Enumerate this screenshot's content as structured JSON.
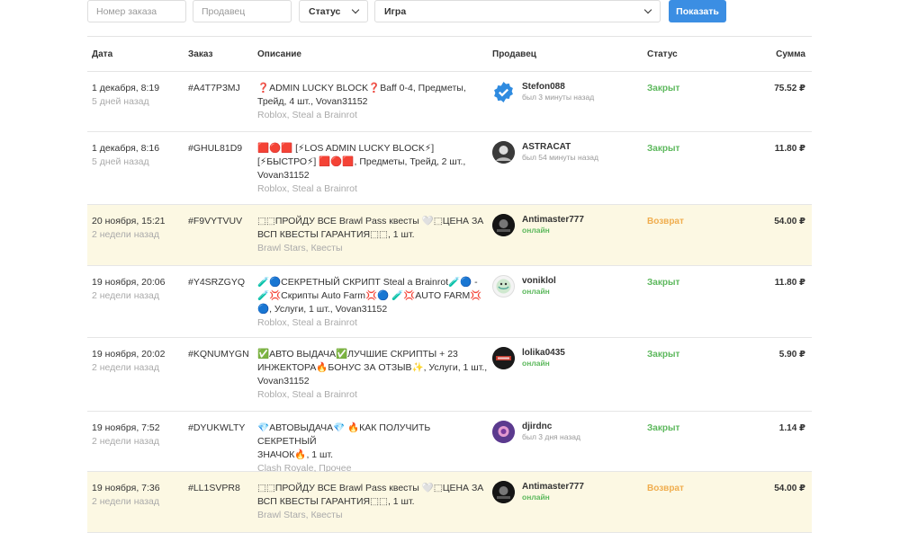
{
  "filters": {
    "order_placeholder": "Номер заказа",
    "seller_placeholder": "Продавец",
    "status_label": "Статус",
    "game_label": "Игра",
    "show_button": "Показать"
  },
  "table": {
    "headers": {
      "date": "Дата",
      "order": "Заказ",
      "description": "Описание",
      "seller": "Продавец",
      "status": "Статус",
      "amount": "Сумма"
    },
    "rows": [
      {
        "date": "1 декабря, 8:19",
        "ago": "5 дней назад",
        "order": "#A4T7P3MJ",
        "desc_lines": [
          "❓ADMIN LUCKY BLOCK❓Baff 0-4, Предметы,",
          "Трейд, 4 шт., Vovan31152"
        ],
        "category": "Roblox, Steal a Brainrot",
        "seller": "Stefon088",
        "seller_status": "был 3 минуты назад",
        "status": "Закрыт",
        "amount": "75.52 ₽"
      },
      {
        "date": "1 декабря, 8:16",
        "ago": "5 дней назад",
        "order": "#GHUL81D9",
        "desc_lines": [
          "🟥🔴🟥 [⚡LOS ADMIN LUCKY BLOCK⚡]",
          "[⚡БЫСТРО⚡] 🟥🔴🟥, Предметы, Трейд, 2 шт.,",
          "Vovan31152"
        ],
        "category": "Roblox, Steal a Brainrot",
        "seller": "ASTRACAT",
        "seller_status": "был 54 минуты назад",
        "status": "Закрыт",
        "amount": "11.80 ₽"
      },
      {
        "date": "20 ноября, 15:21",
        "ago": "2 недели назад",
        "order": "#F9VYTVUV",
        "desc_lines": [
          "⬚⬚ПРОЙДУ ВСЕ Brawl Pass квесты 🤍⬚ЦЕНА ЗА",
          "ВСП КВЕСТЫ ГАРАНТИЯ⬚⬚, 1 шт."
        ],
        "category": "Brawl Stars, Квесты",
        "seller": "Antimaster777",
        "seller_status": "онлайн",
        "status": "Возврат",
        "amount": "54.00 ₽"
      },
      {
        "date": "19 ноября, 20:06",
        "ago": "2 недели назад",
        "order": "#Y4SRZGYQ",
        "desc_lines": [
          "🧪🔵СЕКРЕТНЫЙ СКРИПТ Steal a Brainrot🧪🔵 -",
          "🧪💢Скрипты Auto Farm💢🔵 🧪💢AUTO FARM💢",
          "🔵, Услуги, 1 шт., Vovan31152"
        ],
        "category": "Roblox, Steal a Brainrot",
        "seller": "voniklol",
        "seller_status": "онлайн",
        "status": "Закрыт",
        "amount": "11.80 ₽"
      },
      {
        "date": "19 ноября, 20:02",
        "ago": "2 недели назад",
        "order": "#KQNUMYGN",
        "desc_lines": [
          "✅АВТО ВЫДАЧА✅ЛУЧШИЕ СКРИПТЫ + 23",
          "ИНЖЕКТОРА🔥БОНУС ЗА ОТЗЫВ✨, Услуги, 1 шт.,",
          "Vovan31152"
        ],
        "category": "Roblox, Steal a Brainrot",
        "seller": "lolika0435",
        "seller_status": "онлайн",
        "status": "Закрыт",
        "amount": "5.90 ₽"
      },
      {
        "date": "19 ноября, 7:52",
        "ago": "2 недели назад",
        "order": "#DYUKWLTY",
        "desc_lines": [
          "💎АВТОВЫДАЧА💎 🔥КАК ПОЛУЧИТЬ СЕКРЕТНЫЙ",
          "ЗНАЧОК🔥, 1 шт."
        ],
        "category": "Clash Royale, Прочее",
        "seller": "djirdnc",
        "seller_status": "был 3 дня назад",
        "status": "Закрыт",
        "amount": "1.14 ₽"
      },
      {
        "date": "19 ноября, 7:36",
        "ago": "2 недели назад",
        "order": "#LL1SVPR8",
        "desc_lines": [
          "⬚⬚ПРОЙДУ ВСЕ Brawl Pass квесты 🤍⬚ЦЕНА ЗА",
          "ВСП КВЕСТЫ ГАРАНТИЯ⬚⬚, 1 шт."
        ],
        "category": "Brawl Stars, Квесты",
        "seller": "Antimaster777",
        "seller_status": "онлайн",
        "status": "Возврат",
        "amount": "54.00 ₽"
      }
    ]
  },
  "colors": {
    "closed": "#5cb85c",
    "refund": "#f0ad4e",
    "highlight_row": "#fcf8e3",
    "button": "#3b8ee3"
  }
}
